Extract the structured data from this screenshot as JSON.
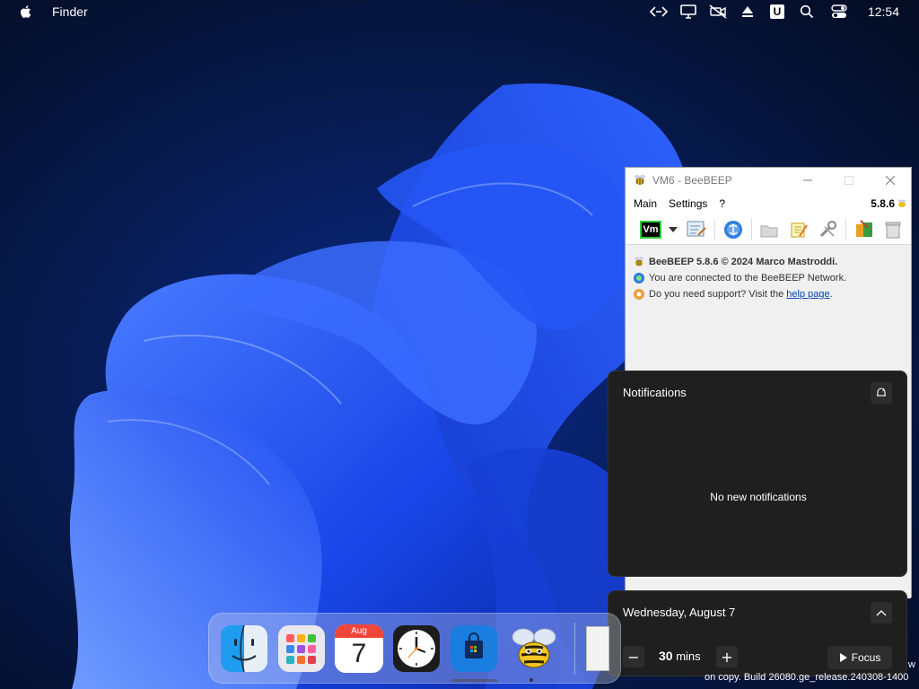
{
  "menubar": {
    "app_name": "Finder",
    "clock": "12:54",
    "u_badge": "U",
    "icons": [
      "apple-logo-icon",
      "code-brackets-icon",
      "display-icon",
      "no-video-icon",
      "eject-icon",
      "u-badge-icon",
      "search-icon",
      "control-center-icon"
    ]
  },
  "beebeep": {
    "title": "VM6 - BeeBEEP",
    "menu": [
      "Main",
      "Settings",
      "?"
    ],
    "version": "5.8.6",
    "toolbar_badge": "Vm",
    "lines": {
      "line1": "BeeBEEP 5.8.6 © 2024 Marco Mastroddi.",
      "line2": "You are connected to the BeeBEEP Network.",
      "line3_prefix": "Do you need support? Visit the ",
      "line3_link": "help page",
      "line3_suffix": "."
    }
  },
  "notifications": {
    "header": "Notifications",
    "empty": "No new notifications"
  },
  "calendar": {
    "date": "Wednesday, August 7",
    "minus": "−",
    "plus": "+",
    "mins_value": "30",
    "mins_unit": "mins",
    "focus_label": "Focus"
  },
  "dock": {
    "calendar_month": "Aug",
    "calendar_day": "7"
  },
  "build_text": "on copy. Build 26080.ge_release.240308-1400",
  "build_w": "w",
  "colors": {
    "accent_blue": "#1a4fff",
    "panel_bg": "#1f1f1f",
    "link": "#0645ad"
  }
}
